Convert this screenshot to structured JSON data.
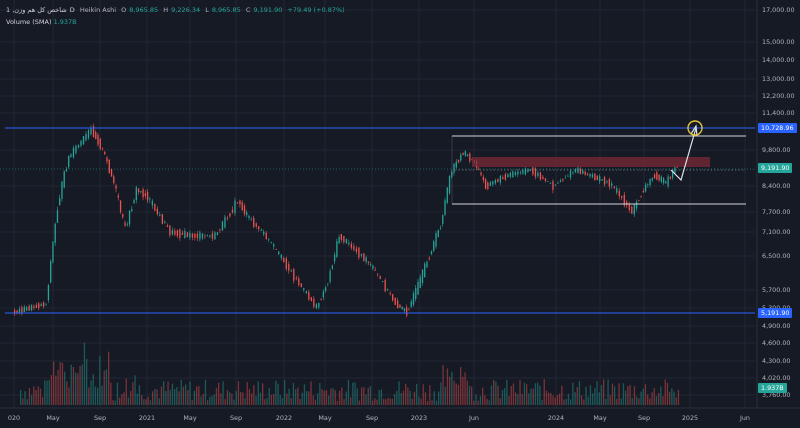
{
  "header": {
    "symbol_title": "1 ,شاخص کل هم وزن",
    "interval": "D",
    "exchange": "",
    "chart_style": "Heikin Ashi",
    "open_label": "O",
    "open": "8,965.85",
    "high_label": "H",
    "high": "9,226.34",
    "low_label": "L",
    "low": "8,965.85",
    "close_label": "C",
    "close": "9,191.90",
    "change": "+79.49 (+0.87%)"
  },
  "volume_header": {
    "label": "Volume (SMA)",
    "value": "1.937B"
  },
  "price_axis": {
    "ticks": [
      "17,000.00",
      "15,000.00",
      "14,000.00",
      "13,000.00",
      "12,200.00",
      "11,400.00",
      "9,800.00",
      "8,400.00",
      "7,700.00",
      "7,100.00",
      "6,500.00",
      "5,700.00",
      "5,300.00",
      "4,900.00",
      "4,600.00",
      "4,300.00",
      "4,020.00",
      "3,760.00"
    ],
    "tag_resistance": "10,728.96",
    "tag_current": "9,191.90",
    "tag_support": "5,191.90",
    "tag_volume": "1.937B"
  },
  "time_axis": {
    "ticks": [
      "020",
      "May",
      "Sep",
      "2021",
      "May",
      "Sep",
      "2022",
      "May",
      "Sep",
      "2023",
      "Jun",
      "2024",
      "May",
      "Sep",
      "2025",
      "Jun"
    ]
  },
  "colors": {
    "background": "#161a25",
    "up": "#26a69a",
    "down": "#ef5350",
    "hline": "#2962ff",
    "channel": "#d1d4dc",
    "zone": "#7b2a35"
  },
  "chart_data": {
    "type": "candlestick",
    "series": [
      {
        "name": "",
        "price_points": [
          [
            "2020-01",
            5200
          ],
          [
            "2020-04",
            5400
          ],
          [
            "2020-05",
            7800
          ],
          [
            "2020-06",
            9500
          ],
          [
            "2020-08",
            10650
          ],
          [
            "2020-09",
            9800
          ],
          [
            "2020-10",
            8500
          ],
          [
            "2020-11",
            7200
          ],
          [
            "2020-12",
            8300
          ],
          [
            "2021-01",
            8100
          ],
          [
            "2021-03",
            7100
          ],
          [
            "2021-05",
            7000
          ],
          [
            "2021-07",
            7000
          ],
          [
            "2021-09",
            8000
          ],
          [
            "2021-10",
            7500
          ],
          [
            "2021-12",
            6800
          ],
          [
            "2022-02",
            6000
          ],
          [
            "2022-04",
            5300
          ],
          [
            "2022-05",
            5900
          ],
          [
            "2022-06",
            7000
          ],
          [
            "2022-08",
            6500
          ],
          [
            "2022-09",
            6200
          ],
          [
            "2022-11",
            5400
          ],
          [
            "2022-12",
            5200
          ],
          [
            "2023-01",
            5800
          ],
          [
            "2023-02",
            6500
          ],
          [
            "2023-03",
            7300
          ],
          [
            "2023-04",
            9000
          ],
          [
            "2023-05",
            9700
          ],
          [
            "2023-06",
            9300
          ],
          [
            "2023-07",
            8400
          ],
          [
            "2023-09",
            8800
          ],
          [
            "2023-11",
            9000
          ],
          [
            "2024-01",
            8400
          ],
          [
            "2024-03",
            9000
          ],
          [
            "2024-06",
            8500
          ],
          [
            "2024-08",
            7700
          ],
          [
            "2024-09",
            8300
          ],
          [
            "2024-10",
            8800
          ],
          [
            "2024-11",
            8500
          ],
          [
            "2024-12",
            9191.9
          ]
        ]
      }
    ],
    "horizontal_lines": [
      10728.96,
      5191.9
    ],
    "channel_top": 10200,
    "channel_bottom": 7700,
    "projection_target": 10728.96,
    "volume_sma": "1.937B"
  }
}
